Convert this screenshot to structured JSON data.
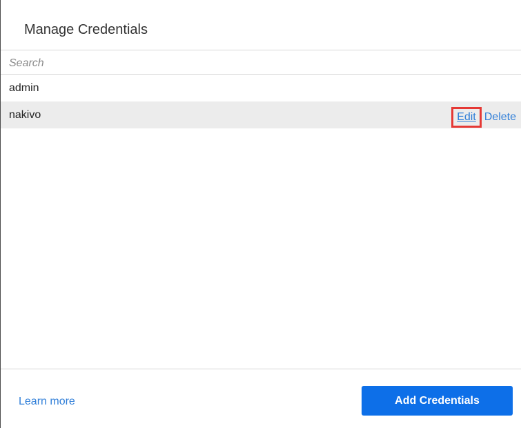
{
  "dialog": {
    "title": "Manage Credentials"
  },
  "search": {
    "placeholder": "Search",
    "value": ""
  },
  "credentials": [
    {
      "name": "admin"
    },
    {
      "name": "nakivo",
      "selected": true,
      "actions": {
        "edit_label": "Edit",
        "delete_label": "Delete"
      }
    }
  ],
  "footer": {
    "learn_more_label": "Learn more",
    "add_button_label": "Add Credentials"
  },
  "colors": {
    "link": "#2f7ed8",
    "primary_button": "#0d6fe8",
    "highlight_border": "#e53935",
    "selected_row": "#ececec"
  }
}
